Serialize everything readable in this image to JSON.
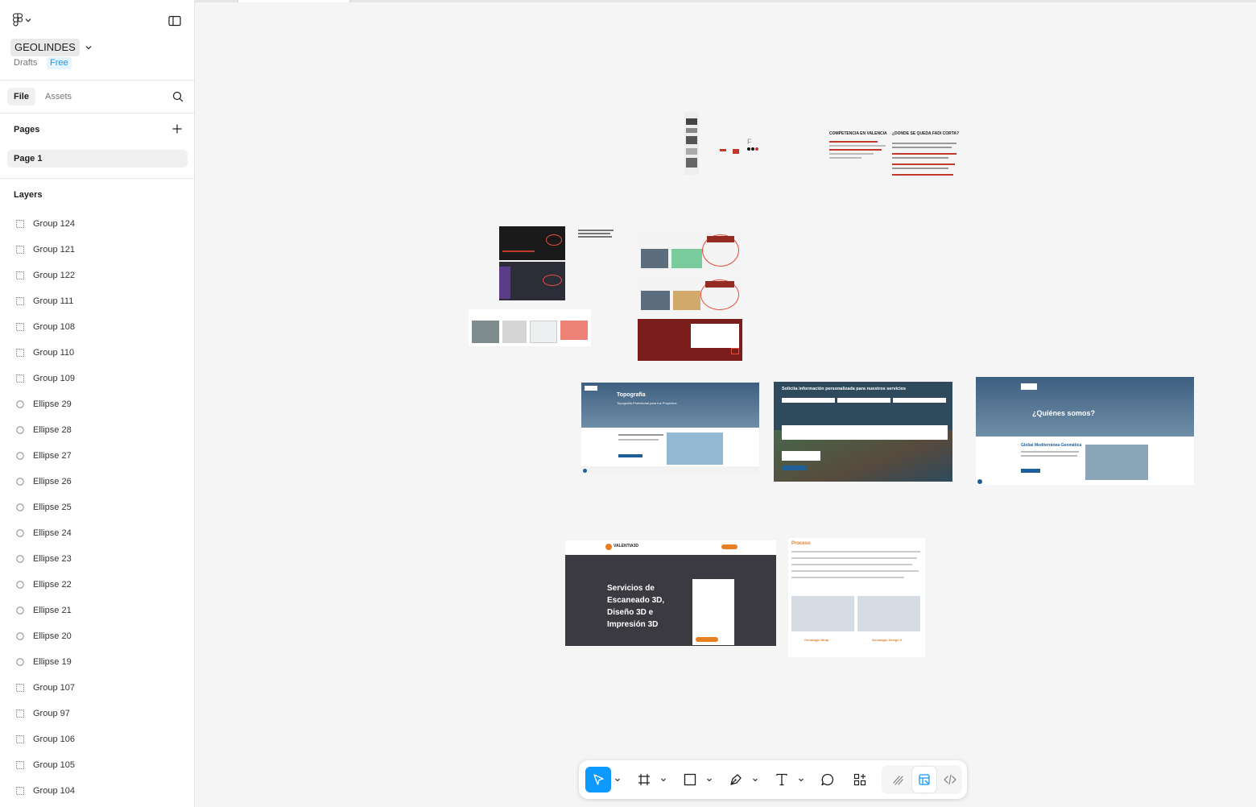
{
  "file": {
    "name": "GEOLINDES",
    "location": "Drafts",
    "plan": "Free"
  },
  "tabs": [
    {
      "label": "File",
      "active": true
    },
    {
      "label": "Assets",
      "active": false
    }
  ],
  "pages": {
    "title": "Pages",
    "items": [
      {
        "label": "Page 1",
        "selected": true
      }
    ]
  },
  "layers": {
    "title": "Layers",
    "items": [
      {
        "label": "Group 124",
        "icon": "frame-icon"
      },
      {
        "label": "Group 121",
        "icon": "frame-icon"
      },
      {
        "label": "Group 122",
        "icon": "frame-icon"
      },
      {
        "label": "Group 111",
        "icon": "frame-icon"
      },
      {
        "label": "Group 108",
        "icon": "frame-icon"
      },
      {
        "label": "Group 110",
        "icon": "frame-icon"
      },
      {
        "label": "Group 109",
        "icon": "frame-icon"
      },
      {
        "label": "Ellipse 29",
        "icon": "ellipse-icon"
      },
      {
        "label": "Ellipse 28",
        "icon": "ellipse-icon"
      },
      {
        "label": "Ellipse 27",
        "icon": "ellipse-icon"
      },
      {
        "label": "Ellipse 26",
        "icon": "ellipse-icon"
      },
      {
        "label": "Ellipse 25",
        "icon": "ellipse-icon"
      },
      {
        "label": "Ellipse 24",
        "icon": "ellipse-icon"
      },
      {
        "label": "Ellipse 23",
        "icon": "ellipse-icon"
      },
      {
        "label": "Ellipse 22",
        "icon": "ellipse-icon"
      },
      {
        "label": "Ellipse 21",
        "icon": "ellipse-icon"
      },
      {
        "label": "Ellipse 20",
        "icon": "ellipse-icon"
      },
      {
        "label": "Ellipse 19",
        "icon": "ellipse-icon"
      },
      {
        "label": "Group 107",
        "icon": "frame-icon"
      },
      {
        "label": "Group 97",
        "icon": "frame-icon"
      },
      {
        "label": "Group 106",
        "icon": "frame-icon"
      },
      {
        "label": "Group 105",
        "icon": "frame-icon"
      },
      {
        "label": "Group 104",
        "icon": "frame-icon"
      }
    ]
  },
  "canvas": {
    "competencia_title": "COMPETENCIA EN VALENCIA",
    "donde_title": "¿DONDE SE QUEDA FADI CORTA?",
    "topografia_title": "Topografía",
    "topografia_sub": "Topografía Profesional para tus Proyectos",
    "solicita_title": "Solicita información personalizada para nuestros servicios",
    "quienes_title": "¿Quiénes somos?",
    "global_sub": "Global Mediterránea-Geomática",
    "valentia_brand": "VALENTIA3D",
    "valentia_hero": "Servicios de Escaneado 3D, Diseño 3D e Impresión 3D",
    "proceso_title": "Proceso",
    "geomagic_wrap": "Geomagic Wrap",
    "geomagic_design": "Geomagic Design X"
  },
  "toolbar": {
    "tools": [
      {
        "name": "move-tool",
        "active": true
      },
      {
        "name": "frame-tool",
        "active": false
      },
      {
        "name": "rectangle-tool",
        "active": false
      },
      {
        "name": "pen-tool",
        "active": false
      },
      {
        "name": "text-tool",
        "active": false
      },
      {
        "name": "comment-tool",
        "active": false
      },
      {
        "name": "actions-tool",
        "active": false
      }
    ],
    "modes": [
      {
        "name": "draw-mode",
        "active": false
      },
      {
        "name": "design-mode",
        "active": true
      },
      {
        "name": "dev-mode",
        "active": false
      }
    ]
  },
  "colors": {
    "accent": "#0d99ff",
    "sidebar_bg": "#ffffff",
    "canvas_bg": "#f5f5f5"
  }
}
